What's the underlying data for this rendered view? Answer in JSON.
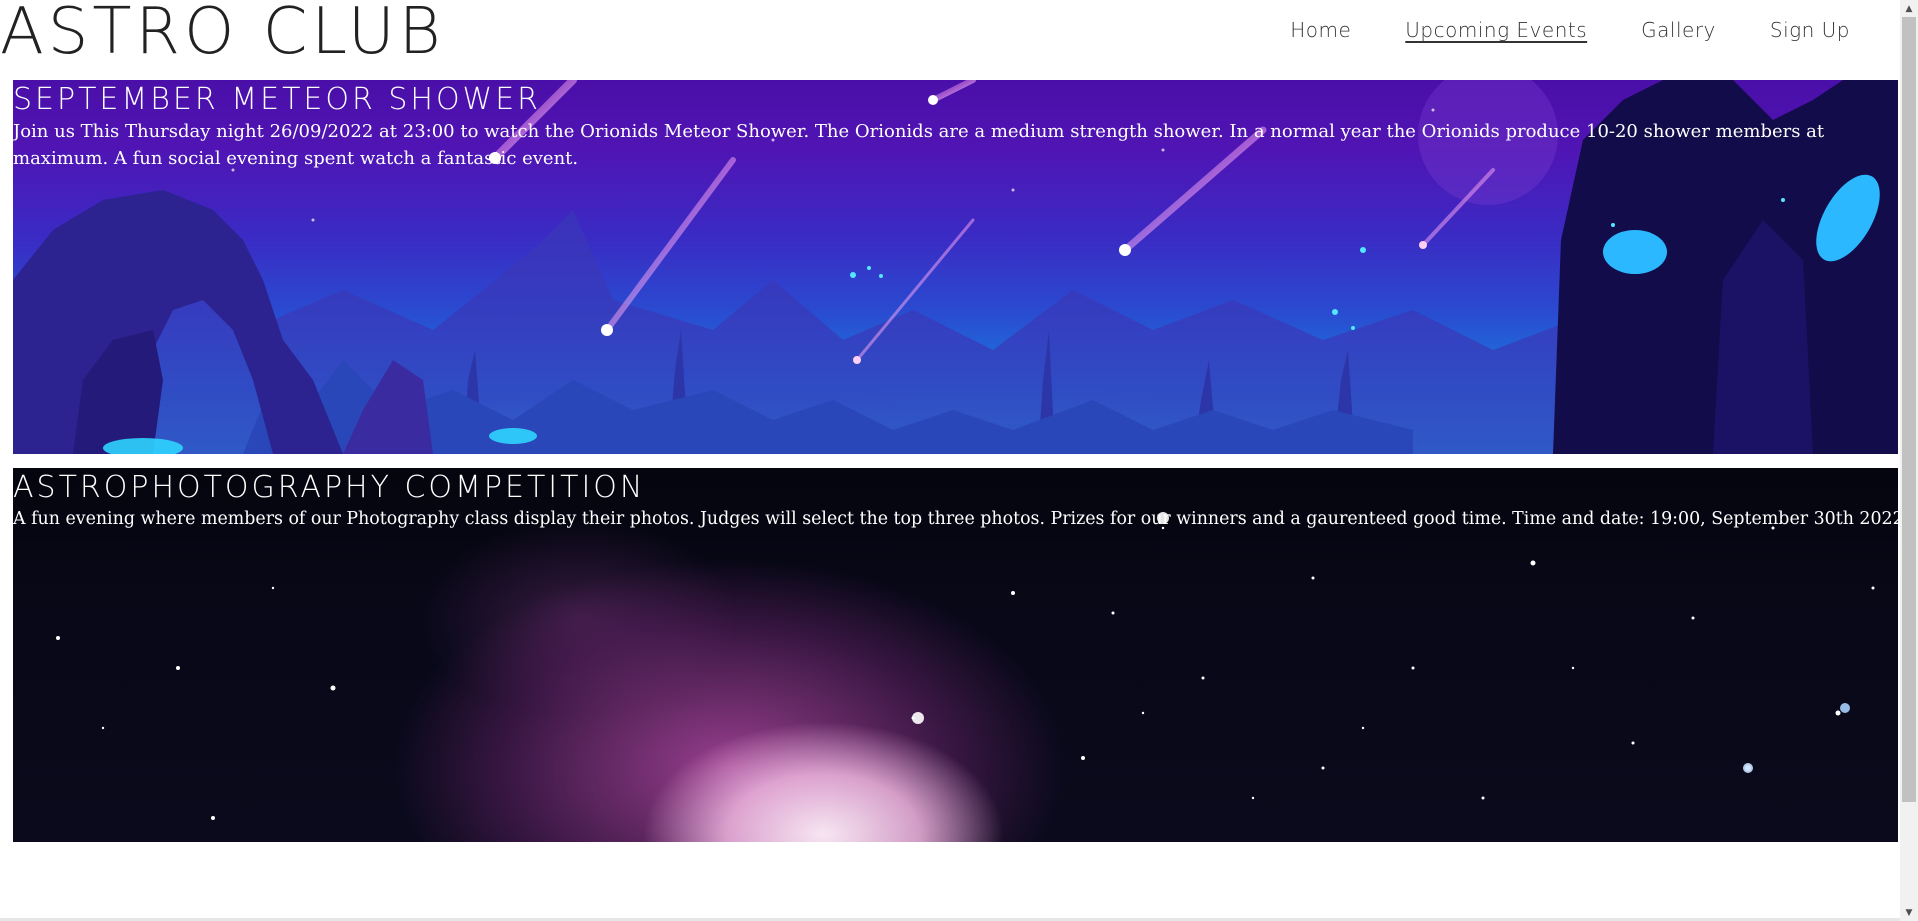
{
  "site": {
    "title": "ASTRO CLUB"
  },
  "nav": {
    "items": [
      {
        "label": "Home"
      },
      {
        "label": "Upcoming Events"
      },
      {
        "label": "Gallery"
      },
      {
        "label": "Sign Up"
      }
    ],
    "active": "Upcoming Events"
  },
  "events": [
    {
      "title": "SEPTEMBER METEOR SHOWER",
      "description": "Join us This Thursday night 26/09/2022 at 23:00 to watch the Orionids Meteor Shower. The Orionids are a medium strength shower. In a normal year the Orionids produce 10-20 shower members at maximum. A fun social evening spent watch a fantastic event.",
      "background": "meteor-shower-illustration"
    },
    {
      "title": "ASTROPHOTOGRAPHY COMPETITION",
      "description": "A fun evening where members of our Photography class display their photos. Judges will select the top three photos. Prizes for our winners and a gaurenteed good time. Time and date: 19:00, September 30th 2022",
      "background": "nebula-photo"
    }
  ],
  "colors": {
    "text_dark": "#222222",
    "banner_text": "#ffffff"
  }
}
